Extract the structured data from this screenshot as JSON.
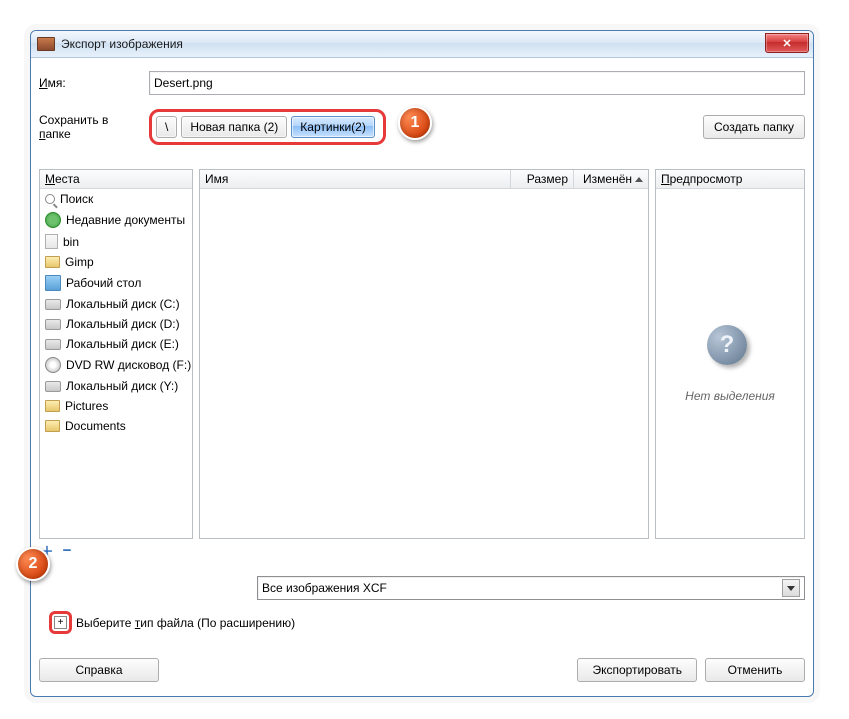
{
  "window": {
    "title": "Экспорт изображения"
  },
  "labels": {
    "name": "Имя:",
    "name_mnemonic_char": "И",
    "save_in": "Сохранить в папке",
    "save_in_mnemonic_char": "п",
    "create_folder": "Создать папку",
    "places_header": "Места",
    "places_mnemonic_char": "М",
    "file_col_name": "Имя",
    "file_col_size": "Размер",
    "file_col_modified": "Изменён",
    "preview_header": "Предпросмотр",
    "preview_mnemonic_char": "П",
    "preview_empty": "Нет выделения",
    "filter_label": "Все изображения XCF",
    "filetype_expander": "Выберите тип файла (По расширению)",
    "filetype_mnemonic_char": "т",
    "help": "Справка",
    "export": "Экспортировать",
    "cancel": "Отменить"
  },
  "filename": "Desert.png",
  "path_crumbs": {
    "root": "\\",
    "folder1": "Новая папка (2)",
    "folder2": "Картинки(2)"
  },
  "places": [
    {
      "icon": "search",
      "label": "Поиск"
    },
    {
      "icon": "clock",
      "label": "Недавние документы"
    },
    {
      "icon": "file",
      "label": "bin"
    },
    {
      "icon": "folder",
      "label": "Gimp"
    },
    {
      "icon": "desk",
      "label": "Рабочий стол"
    },
    {
      "icon": "drive",
      "label": "Локальный диск (C:)"
    },
    {
      "icon": "drive",
      "label": "Локальный диск (D:)"
    },
    {
      "icon": "drive",
      "label": "Локальный диск (E:)"
    },
    {
      "icon": "dvd",
      "label": "DVD RW дисковод (F:)"
    },
    {
      "icon": "drive",
      "label": "Локальный диск (Y:)"
    },
    {
      "icon": "folder",
      "label": "Pictures"
    },
    {
      "icon": "folder",
      "label": "Documents"
    }
  ],
  "annotations": {
    "badge1": "1",
    "badge2": "2"
  }
}
